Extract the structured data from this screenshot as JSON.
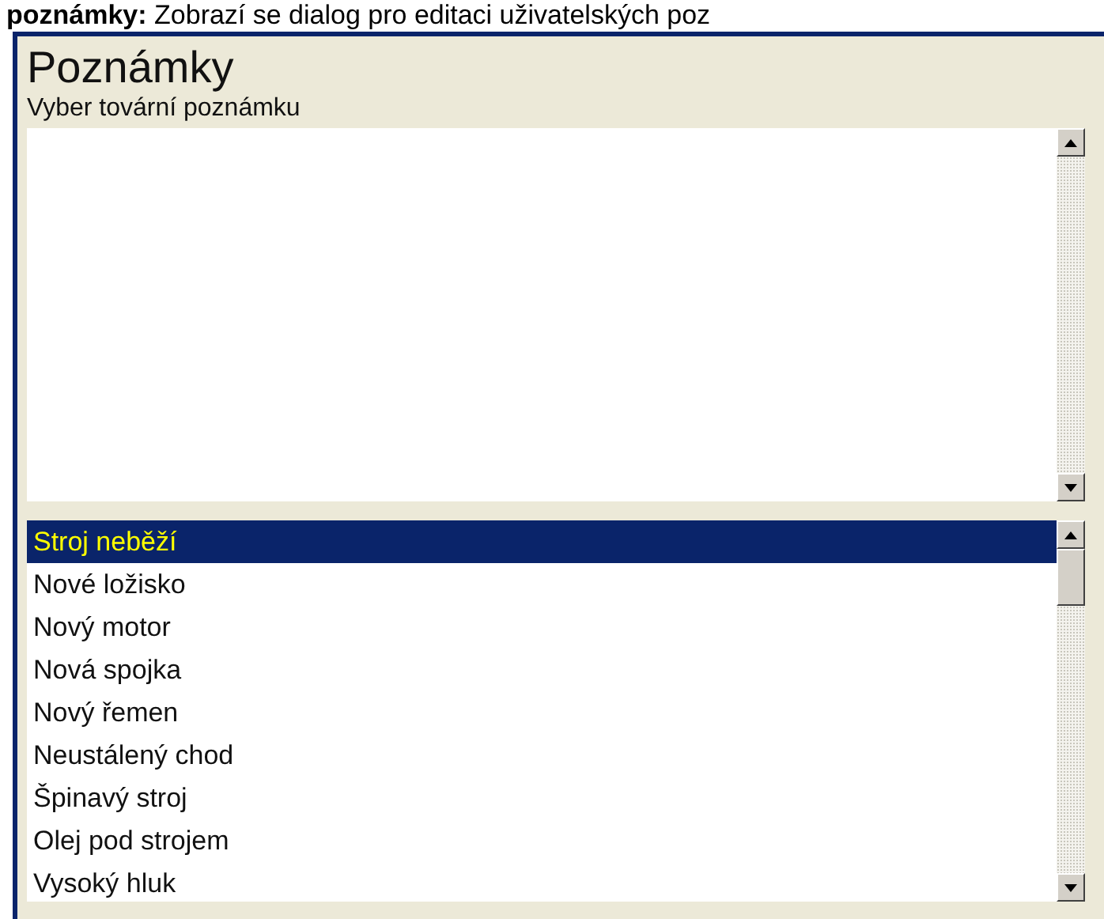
{
  "caption": "**poznámky:** Zobrazí se dialog pro editaci uživatelských poz",
  "dialog": {
    "title": "Poznámky",
    "subtitle": "Vyber tovární poznámku"
  },
  "notes_list": [
    {
      "label": "Stroj neběží",
      "selected": true
    },
    {
      "label": "Nové ložisko",
      "selected": false
    },
    {
      "label": "Nový motor",
      "selected": false
    },
    {
      "label": "Nová spojka",
      "selected": false
    },
    {
      "label": "Nový řemen",
      "selected": false
    },
    {
      "label": "Neustálený chod",
      "selected": false
    },
    {
      "label": "Špinavý stroj",
      "selected": false
    },
    {
      "label": "Olej pod strojem",
      "selected": false
    },
    {
      "label": "Vysoký hluk",
      "selected": false
    }
  ]
}
